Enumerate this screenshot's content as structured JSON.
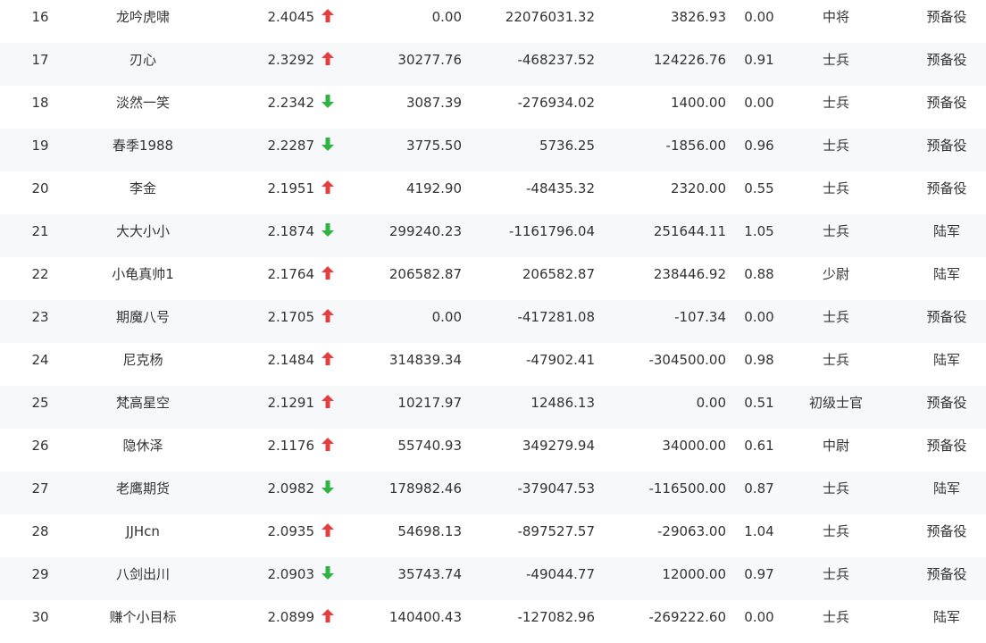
{
  "colors": {
    "up": "#e53e3e",
    "down": "#2fb344"
  },
  "rows": [
    {
      "rank": "16",
      "name": "龙吟虎啸",
      "score": "2.4045",
      "trend": "up",
      "v1": "0.00",
      "v2": "22076031.32",
      "v3": "3826.93",
      "v4": "0.00",
      "rank_name": "中将",
      "branch": "预备役"
    },
    {
      "rank": "17",
      "name": "刃心",
      "score": "2.3292",
      "trend": "up",
      "v1": "30277.76",
      "v2": "-468237.52",
      "v3": "124226.76",
      "v4": "0.91",
      "rank_name": "士兵",
      "branch": "预备役"
    },
    {
      "rank": "18",
      "name": "淡然一笑",
      "score": "2.2342",
      "trend": "down",
      "v1": "3087.39",
      "v2": "-276934.02",
      "v3": "1400.00",
      "v4": "0.00",
      "rank_name": "士兵",
      "branch": "预备役"
    },
    {
      "rank": "19",
      "name": "春季1988",
      "score": "2.2287",
      "trend": "down",
      "v1": "3775.50",
      "v2": "5736.25",
      "v3": "-1856.00",
      "v4": "0.96",
      "rank_name": "士兵",
      "branch": "预备役"
    },
    {
      "rank": "20",
      "name": "李金",
      "score": "2.1951",
      "trend": "up",
      "v1": "4192.90",
      "v2": "-48435.32",
      "v3": "2320.00",
      "v4": "0.55",
      "rank_name": "士兵",
      "branch": "预备役"
    },
    {
      "rank": "21",
      "name": "大大小小",
      "score": "2.1874",
      "trend": "down",
      "v1": "299240.23",
      "v2": "-1161796.04",
      "v3": "251644.11",
      "v4": "1.05",
      "rank_name": "士兵",
      "branch": "陆军"
    },
    {
      "rank": "22",
      "name": "小龟真帅1",
      "score": "2.1764",
      "trend": "up",
      "v1": "206582.87",
      "v2": "206582.87",
      "v3": "238446.92",
      "v4": "0.88",
      "rank_name": "少尉",
      "branch": "陆军"
    },
    {
      "rank": "23",
      "name": "期魔八号",
      "score": "2.1705",
      "trend": "up",
      "v1": "0.00",
      "v2": "-417281.08",
      "v3": "-107.34",
      "v4": "0.00",
      "rank_name": "士兵",
      "branch": "预备役"
    },
    {
      "rank": "24",
      "name": "尼克杨",
      "score": "2.1484",
      "trend": "up",
      "v1": "314839.34",
      "v2": "-47902.41",
      "v3": "-304500.00",
      "v4": "0.98",
      "rank_name": "士兵",
      "branch": "陆军"
    },
    {
      "rank": "25",
      "name": "梵高星空",
      "score": "2.1291",
      "trend": "up",
      "v1": "10217.97",
      "v2": "12486.13",
      "v3": "0.00",
      "v4": "0.51",
      "rank_name": "初级士官",
      "branch": "预备役"
    },
    {
      "rank": "26",
      "name": "隐休泽",
      "score": "2.1176",
      "trend": "up",
      "v1": "55740.93",
      "v2": "349279.94",
      "v3": "34000.00",
      "v4": "0.61",
      "rank_name": "中尉",
      "branch": "预备役"
    },
    {
      "rank": "27",
      "name": "老鹰期货",
      "score": "2.0982",
      "trend": "down",
      "v1": "178982.46",
      "v2": "-379047.53",
      "v3": "-116500.00",
      "v4": "0.87",
      "rank_name": "士兵",
      "branch": "陆军"
    },
    {
      "rank": "28",
      "name": "JJHcn",
      "score": "2.0935",
      "trend": "up",
      "v1": "54698.13",
      "v2": "-897527.57",
      "v3": "-29063.00",
      "v4": "1.04",
      "rank_name": "士兵",
      "branch": "预备役"
    },
    {
      "rank": "29",
      "name": "八剑出川",
      "score": "2.0903",
      "trend": "down",
      "v1": "35743.74",
      "v2": "-49044.77",
      "v3": "12000.00",
      "v4": "0.97",
      "rank_name": "士兵",
      "branch": "预备役"
    },
    {
      "rank": "30",
      "name": "赚个小目标",
      "score": "2.0899",
      "trend": "up",
      "v1": "140400.43",
      "v2": "-127082.96",
      "v3": "-269222.60",
      "v4": "0.00",
      "rank_name": "士兵",
      "branch": "陆军"
    }
  ]
}
